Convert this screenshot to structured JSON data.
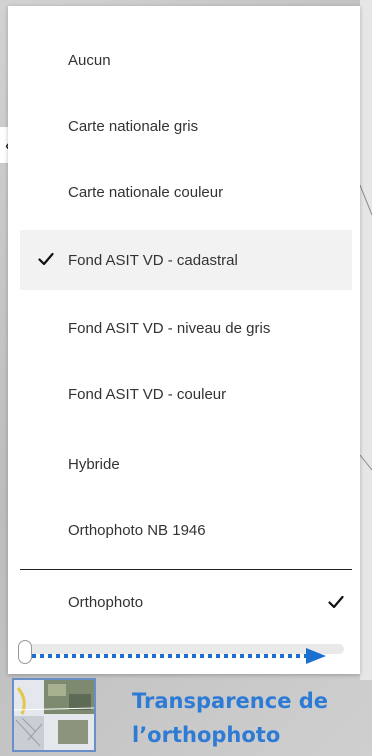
{
  "menu": {
    "items": [
      {
        "label": "Aucun",
        "selected": false
      },
      {
        "label": "Carte nationale gris",
        "selected": false
      },
      {
        "label": "Carte nationale couleur",
        "selected": false
      },
      {
        "label": "Fond ASIT VD - cadastral",
        "selected": true
      },
      {
        "label": "Fond ASIT VD - niveau de gris",
        "selected": false
      },
      {
        "label": "Fond ASIT VD - couleur",
        "selected": false
      },
      {
        "label": "Hybride",
        "selected": false
      },
      {
        "label": "Orthophoto NB 1946",
        "selected": false
      }
    ],
    "overlay": {
      "label": "Orthophoto",
      "checked": true
    }
  },
  "slider": {
    "value": 0
  },
  "caption": {
    "line1": "Transparence de",
    "line2": "l’orthophoto"
  },
  "colors": {
    "accent": "#2e7bd6",
    "arrow": "#1a6fd1"
  }
}
